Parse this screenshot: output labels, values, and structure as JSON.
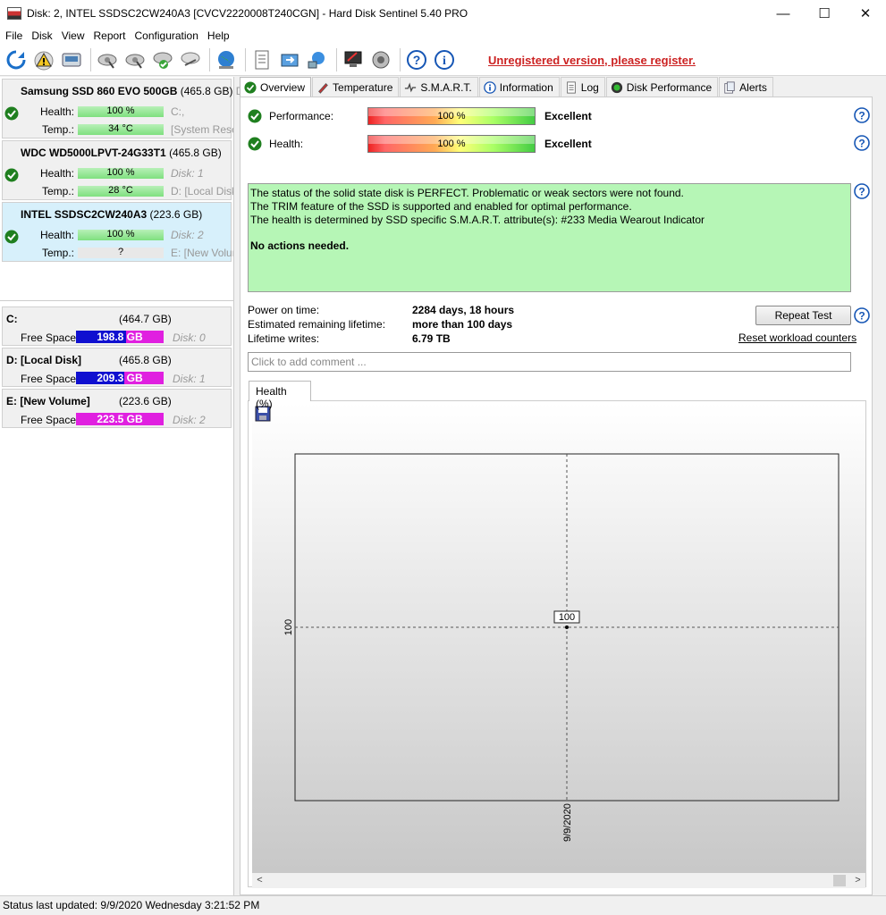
{
  "window": {
    "title": "Disk: 2, INTEL SSDSC2CW240A3 [CVCV2220008T240CGN]  -  Hard Disk Sentinel 5.40 PRO",
    "minimize": "—",
    "maximize": "☐",
    "close": "✕"
  },
  "menu": [
    {
      "label": "File"
    },
    {
      "label": "Disk"
    },
    {
      "label": "View"
    },
    {
      "label": "Report"
    },
    {
      "label": "Configuration"
    },
    {
      "label": "Help"
    }
  ],
  "toolbar": {
    "register_text": "Unregistered version, please register."
  },
  "disks": [
    {
      "name": "Samsung SSD 860 EVO 500GB",
      "size": "(465.8 GB)",
      "size_suffix": "Di",
      "health_label": "Health:",
      "health": "100 %",
      "health_pct": 100,
      "temp_label": "Temp.:",
      "temp": "34 °C",
      "temp_pct": 100,
      "side1": "C:,",
      "side2": "[System Rese"
    },
    {
      "name": "WDC WD5000LPVT-24G33T1",
      "size": "(465.8 GB)",
      "size_suffix": "",
      "health_label": "Health:",
      "health": "100 %",
      "health_pct": 100,
      "temp_label": "Temp.:",
      "temp": "28 °C",
      "temp_pct": 100,
      "side1": "Disk: 1",
      "side2": "D: [Local Disk"
    },
    {
      "name": "INTEL SSDSC2CW240A3",
      "size": "(223.6 GB)",
      "size_suffix": "",
      "health_label": "Health:",
      "health": "100 %",
      "health_pct": 100,
      "temp_label": "Temp.:",
      "temp": "?",
      "temp_pct": 0,
      "side1": "Disk: 2",
      "side2": "E: [New Volun"
    }
  ],
  "volumes": [
    {
      "name": "C:",
      "size": "(464.7 GB)",
      "free_label": "Free Space",
      "free": "198.8 GB",
      "used_pct": 57,
      "disk": "Disk: 0"
    },
    {
      "name": "D: [Local Disk]",
      "size": "(465.8 GB)",
      "free_label": "Free Space",
      "free": "209.3 GB",
      "used_pct": 55,
      "disk": "Disk: 1"
    },
    {
      "name": "E: [New Volume]",
      "size": "(223.6 GB)",
      "free_label": "Free Space",
      "free": "223.5 GB",
      "used_pct": 0,
      "disk": "Disk: 2"
    }
  ],
  "tabs": [
    {
      "label": "Overview",
      "icon": "check-icon"
    },
    {
      "label": "Temperature",
      "icon": "thermometer-icon"
    },
    {
      "label": "S.M.A.R.T.",
      "icon": "smart-icon"
    },
    {
      "label": "Information",
      "icon": "info-icon"
    },
    {
      "label": "Log",
      "icon": "log-icon"
    },
    {
      "label": "Disk Performance",
      "icon": "performance-icon"
    },
    {
      "label": "Alerts",
      "icon": "alerts-icon"
    }
  ],
  "overview": {
    "performance_label": "Performance:",
    "performance": "100 %",
    "performance_pct": 100,
    "performance_rating": "Excellent",
    "health_label": "Health:",
    "health": "100 %",
    "health_pct": 100,
    "health_rating": "Excellent",
    "message_lines": [
      "The status of the solid state disk is PERFECT. Problematic or weak sectors were not found.",
      "The TRIM feature of the SSD is supported and enabled for optimal performance.",
      "The health is determined by SSD specific S.M.A.R.T. attribute(s):  #233 Media Wearout Indicator"
    ],
    "message_action": "No actions needed.",
    "power_on_label": "Power on time:",
    "power_on": "2284 days, 18 hours",
    "remaining_label": "Estimated remaining lifetime:",
    "remaining": "more than 100 days",
    "writes_label": "Lifetime writes:",
    "writes": "6.79 TB",
    "repeat_test": "Repeat Test",
    "reset_workload": "Reset workload counters",
    "comment_placeholder": "Click to add comment ..."
  },
  "chart_tab": "Health (%)",
  "chart_data": {
    "type": "line",
    "x": [
      "9/9/2020"
    ],
    "series": [
      {
        "values": [
          100
        ]
      }
    ],
    "ylabel_tick": "100",
    "data_label": "100",
    "grid": true
  },
  "statusbar": {
    "text": "Status last updated: 9/9/2020 Wednesday 3:21:52 PM"
  }
}
